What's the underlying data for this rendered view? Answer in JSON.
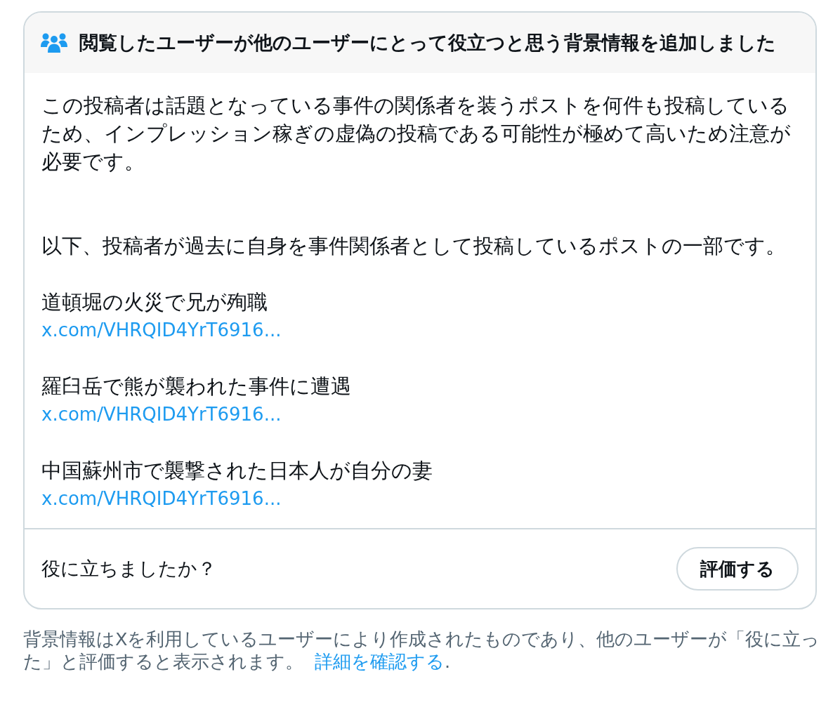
{
  "note": {
    "header": "閲覧したユーザーが他のユーザーにとって役立つと思う背景情報を追加しました",
    "paragraphs": [
      "この投稿者は話題となっている事件の関係者を装うポストを何件も投稿しているため、インプレッション稼ぎの虚偽の投稿である可能性が極めて高いため注意が必要です。",
      "以下、投稿者が過去に自身を事件関係者として投稿しているポストの一部です。"
    ],
    "examples": [
      {
        "title": "道頓堀の火災で兄が殉職",
        "link": "x.com/VHRQID4YrT6916..."
      },
      {
        "title": "羅臼岳で熊が襲われた事件に遭遇",
        "link": "x.com/VHRQID4YrT6916..."
      },
      {
        "title": "中国蘇州市で襲撃された日本人が自分の妻",
        "link": "x.com/VHRQID4YrT6916..."
      }
    ],
    "question": "役に立ちましたか？",
    "rate_button": "評価する"
  },
  "footer": {
    "text": "背景情報はXを利用しているユーザーにより作成されたものであり、他のユーザーが「役に立った」と評価すると表示されます。",
    "link": "詳細を確認する",
    "text_after": "."
  }
}
